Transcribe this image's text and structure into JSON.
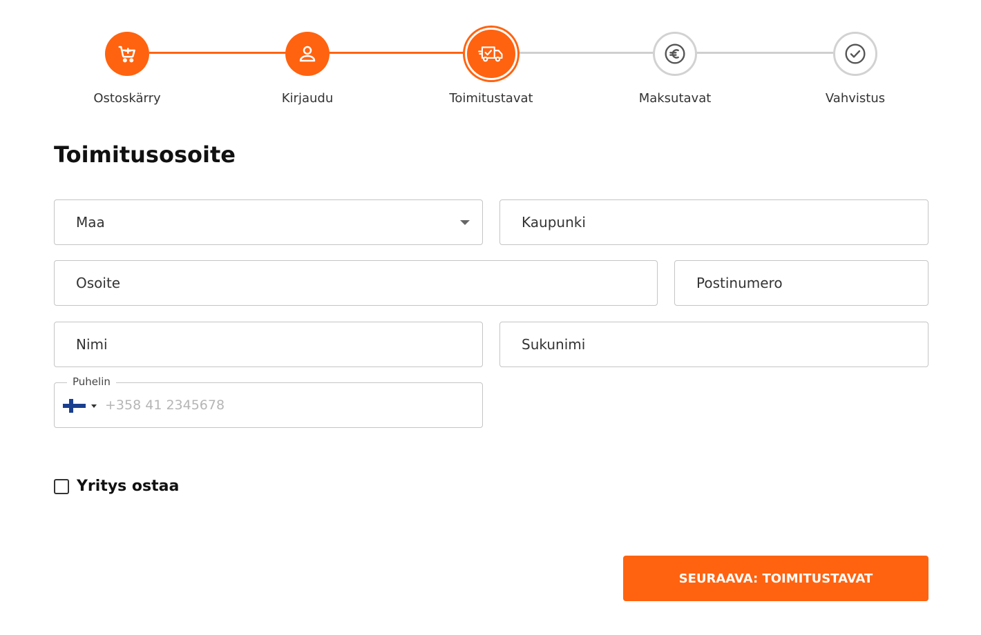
{
  "stepper": {
    "steps": [
      {
        "label": "Ostoskärry",
        "status": "done",
        "icon": "cart-icon"
      },
      {
        "label": "Kirjaudu",
        "status": "done",
        "icon": "user-icon"
      },
      {
        "label": "Toimitustavat",
        "status": "current",
        "icon": "delivery-truck-icon"
      },
      {
        "label": "Maksutavat",
        "status": "todo",
        "icon": "euro-icon"
      },
      {
        "label": "Vahvistus",
        "status": "todo",
        "icon": "check-circle-icon"
      }
    ]
  },
  "form": {
    "title": "Toimitusosoite",
    "country_label": "Maa",
    "city_label": "Kaupunki",
    "address_label": "Osoite",
    "postal_label": "Postinumero",
    "first_name_label": "Nimi",
    "last_name_label": "Sukunimi",
    "phone_label": "Puhelin",
    "phone_placeholder": "+358 41 2345678",
    "phone_country_flag": "finland-flag-icon",
    "company_checkbox_label": "Yritys ostaa"
  },
  "actions": {
    "next_label": "SEURAAVA: TOIMITUSTAVAT"
  },
  "colors": {
    "accent": "#ff6310",
    "inactive": "#d2d2d2",
    "border": "#c4c4c4"
  }
}
